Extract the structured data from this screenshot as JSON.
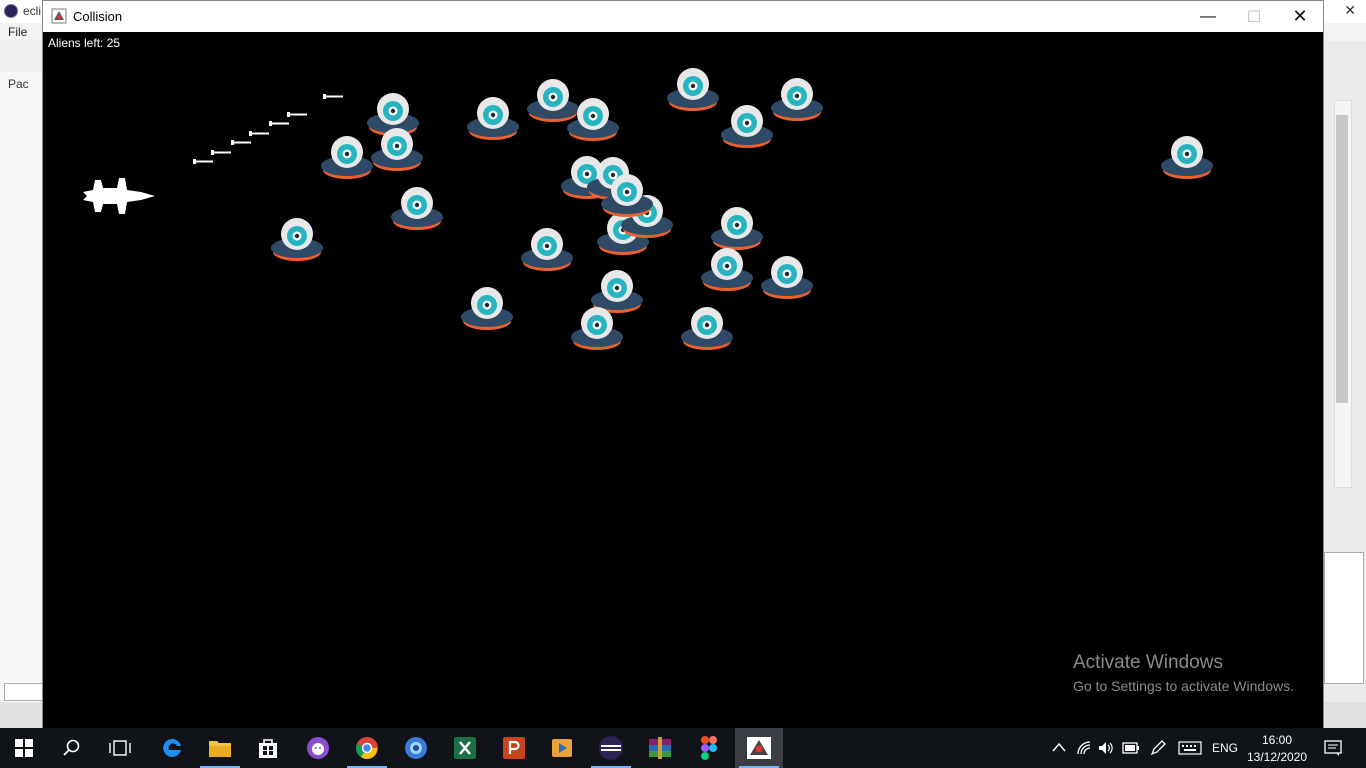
{
  "background_app": {
    "title": "ecli",
    "menu_file": "File",
    "left_tab": "Pac"
  },
  "game_window": {
    "title": "Collision",
    "hud_text": "Aliens left: 25"
  },
  "watermark": {
    "title": "Activate Windows",
    "subtitle": "Go to Settings to activate Windows."
  },
  "taskbar": {
    "language": "ENG",
    "time": "16:00",
    "date": "13/12/2020",
    "apps": [
      "start",
      "search",
      "task-view",
      "edge",
      "file-explorer",
      "store",
      "github-desktop",
      "chrome",
      "app-circle",
      "excel",
      "powerpoint",
      "media-player",
      "eclipse",
      "winrar",
      "figma",
      "java-collision"
    ]
  },
  "colors": {
    "canvas": "#000000",
    "alien_body": "#2f4a66",
    "alien_dome": "#e8e8e8",
    "alien_eye": "#26b5c0",
    "alien_ring": "#f0602a"
  },
  "sprites": {
    "player": "jet-fighter",
    "enemy": "ufo-alien",
    "projectile": "missile"
  }
}
